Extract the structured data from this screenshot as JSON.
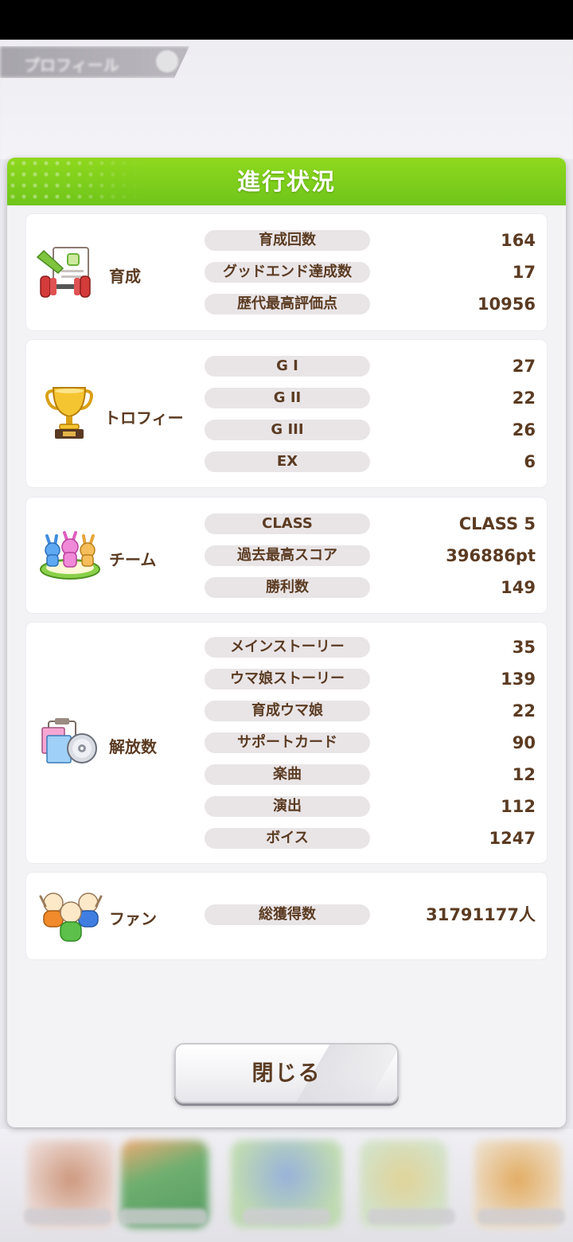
{
  "background": {
    "profile_tab": "プロフィール"
  },
  "dialog": {
    "title": "進行状況",
    "close_label": "閉じる"
  },
  "sections": {
    "training": {
      "label": "育成",
      "icon": "training-icon",
      "rows": [
        {
          "label": "育成回数",
          "value": "164"
        },
        {
          "label": "グッドエンド達成数",
          "value": "17"
        },
        {
          "label": "歴代最高評価点",
          "value": "10956"
        }
      ]
    },
    "trophy": {
      "label": "トロフィー",
      "icon": "trophy-icon",
      "rows": [
        {
          "label": "G I",
          "value": "27"
        },
        {
          "label": "G II",
          "value": "22"
        },
        {
          "label": "G III",
          "value": "26"
        },
        {
          "label": "EX",
          "value": "6"
        }
      ]
    },
    "team": {
      "label": "チーム",
      "icon": "team-icon",
      "rows": [
        {
          "label": "CLASS",
          "value": "CLASS 5"
        },
        {
          "label": "過去最高スコア",
          "value": "396886pt"
        },
        {
          "label": "勝利数",
          "value": "149"
        }
      ]
    },
    "unlocks": {
      "label": "解放数",
      "icon": "unlock-icon",
      "rows": [
        {
          "label": "メインストーリー",
          "value": "35"
        },
        {
          "label": "ウマ娘ストーリー",
          "value": "139"
        },
        {
          "label": "育成ウマ娘",
          "value": "22"
        },
        {
          "label": "サポートカード",
          "value": "90"
        },
        {
          "label": "楽曲",
          "value": "12"
        },
        {
          "label": "演出",
          "value": "112"
        },
        {
          "label": "ボイス",
          "value": "1247"
        }
      ]
    },
    "fans": {
      "label": "ファン",
      "icon": "fans-icon",
      "rows": [
        {
          "label": "総獲得数",
          "value": "31791177人"
        }
      ]
    }
  }
}
